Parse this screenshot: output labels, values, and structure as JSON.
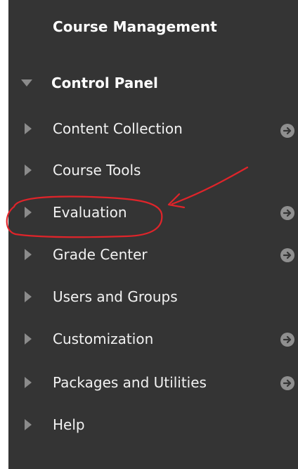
{
  "header": {
    "title": "Course Management"
  },
  "control_panel": {
    "label": "Control Panel"
  },
  "items": [
    {
      "label": "Content Collection",
      "has_arrow": true
    },
    {
      "label": "Course Tools",
      "has_arrow": false
    },
    {
      "label": "Evaluation",
      "has_arrow": true
    },
    {
      "label": "Grade Center",
      "has_arrow": true
    },
    {
      "label": "Users and Groups",
      "has_arrow": false
    },
    {
      "label": "Customization",
      "has_arrow": true
    },
    {
      "label": "Packages and Utilities",
      "has_arrow": true
    },
    {
      "label": "Help",
      "has_arrow": false
    }
  ],
  "colors": {
    "panel_bg": "#343434",
    "text": "#ffffff",
    "triangle": "#8b8b8b",
    "annotation": "#e0242a"
  },
  "icons": {
    "expand": "triangle-down-icon",
    "collapsed": "triangle-right-icon",
    "go": "arrow-circle-right-icon"
  }
}
